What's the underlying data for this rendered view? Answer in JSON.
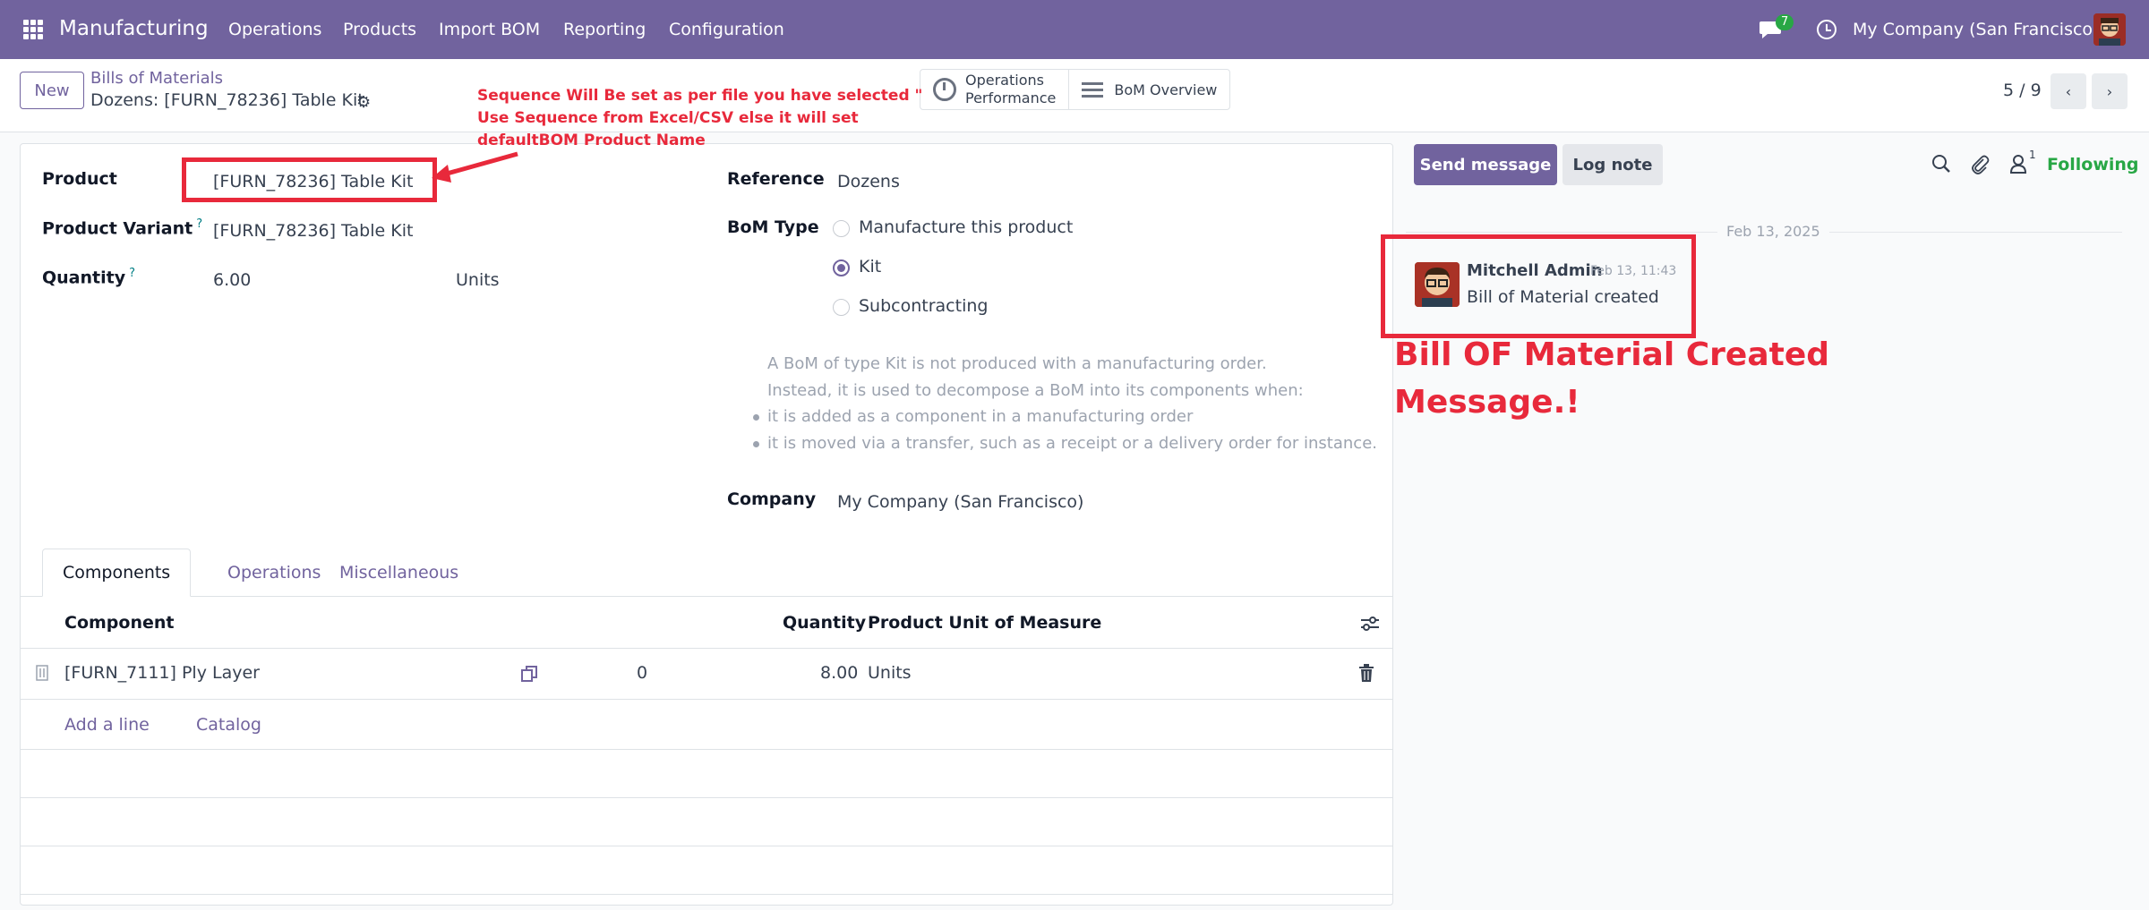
{
  "navbar": {
    "app_name": "Manufacturing",
    "menu": [
      "Operations",
      "Products",
      "Import BOM",
      "Reporting",
      "Configuration"
    ],
    "chat_count": "7",
    "company": "My Company (San Francisco)"
  },
  "control_panel": {
    "new_label": "New",
    "breadcrumb_parent": "Bills of Materials",
    "breadcrumb_current": "Dozens: [FURN_78236] Table Kit",
    "stat_operations_line1": "Operations",
    "stat_operations_line2": "Performance",
    "stat_bom_overview": "BoM Overview",
    "pager": "5 / 9"
  },
  "form": {
    "product_label": "Product",
    "product_value": "[FURN_78236] Table Kit",
    "variant_label": "Product Variant",
    "variant_help": "?",
    "variant_value": "[FURN_78236] Table Kit",
    "quantity_label": "Quantity",
    "quantity_help": "?",
    "quantity_value": "6.00",
    "quantity_uom": "Units",
    "reference_label": "Reference",
    "reference_value": "Dozens",
    "bom_type_label": "BoM Type",
    "bom_types": [
      "Manufacture this product",
      "Kit",
      "Subcontracting"
    ],
    "bom_type_selected": "Kit",
    "help_line1": "A BoM of type Kit is not produced with a manufacturing order.",
    "help_line2": "Instead, it is used to decompose a BoM into its components when:",
    "help_bullet1": "it is added as a component in a manufacturing order",
    "help_bullet2": "it is moved via a transfer, such as a receipt or a delivery order for instance.",
    "company_label": "Company",
    "company_value": "My Company (San Francisco)"
  },
  "tabs": [
    "Components",
    "Operations",
    "Miscellaneous"
  ],
  "components_table": {
    "headers": [
      "Component",
      "Quantity",
      "Product Unit of Measure"
    ],
    "rows": [
      {
        "component": "[FURN_7111] Ply Layer",
        "forecast": "0",
        "quantity": "8.00",
        "uom": "Units"
      }
    ],
    "add_line": "Add a line",
    "catalog": "Catalog"
  },
  "chatter": {
    "send_message": "Send message",
    "log_note": "Log note",
    "followers_count": "1",
    "following": "Following",
    "date": "Feb 13, 2025",
    "message": {
      "author": "Mitchell Admin",
      "time": "Feb 13, 11:43",
      "body": "Bill of Material created"
    }
  },
  "annotations": {
    "sequence_note": "Sequence Will Be set as per file you have selected \" Use Sequence from Excel/CSV else it will set defaultBOM Product Name",
    "created_note": "Bill OF Material Created Message.!"
  },
  "colors": {
    "brand": "#71639e",
    "annotation": "#e8293b",
    "following": "#28a745"
  },
  "icons": [
    "apps-grid-icon",
    "chat-icon",
    "clock-icon",
    "gear-icon",
    "operations-performance-icon",
    "bom-overview-icon",
    "search-icon",
    "paperclip-icon",
    "followers-icon",
    "copy-icon",
    "trash-icon",
    "optional-columns-icon",
    "drag-handle-icon"
  ]
}
